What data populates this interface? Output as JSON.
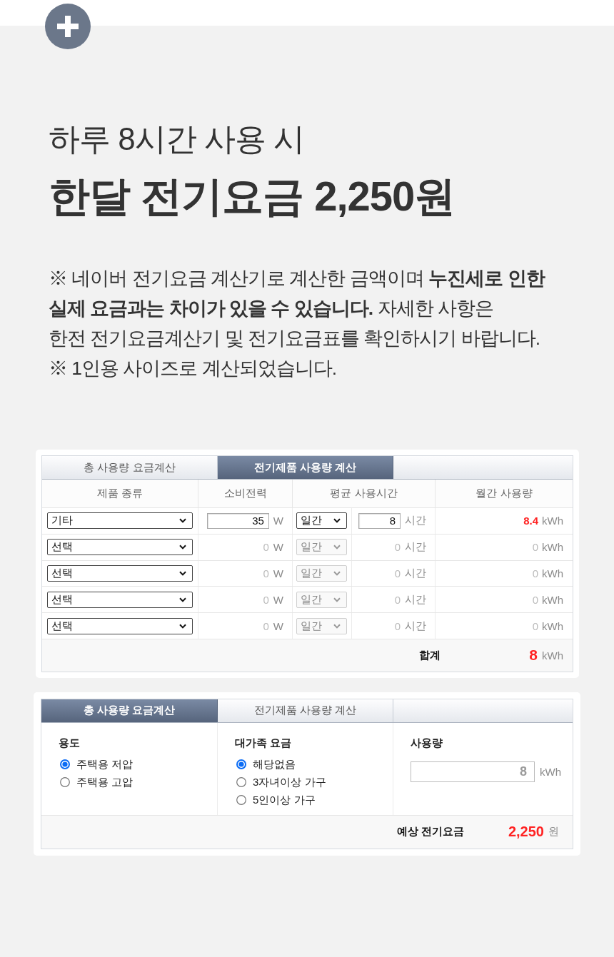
{
  "header": {
    "subtitle": "하루 8시간 사용 시",
    "headline": "한달 전기요금 2,250원"
  },
  "notes": [
    "※ 네이버 전기요금 계산기로 계산한 금액이며 **누진세로 인한**\n**실제 요금과는 차이가 있을 수 있습니다.** 자세한 사항은\n한전 전기요금계산기 및 전기요금표를 확인하시기 바랍니다.",
    "※ 1인용 사이즈로 계산되었습니다."
  ],
  "appliance_calculator": {
    "tabs": [
      {
        "label": "총 사용량 요금계산",
        "selected": false
      },
      {
        "label": "전기제품 사용량 계산",
        "selected": true
      }
    ],
    "columns": [
      "제품 종류",
      "소비전력",
      "평균 사용시간",
      "월간 사용량"
    ],
    "rows": [
      {
        "disabled": false,
        "product": "기타",
        "power": "35",
        "power_unit": "W",
        "period": "일간",
        "hours": "8",
        "hours_unit": "시간",
        "usage": "8.4",
        "usage_unit": "kWh"
      },
      {
        "disabled": true,
        "product": "선택",
        "power": "0",
        "power_unit": "W",
        "period": "일간",
        "hours": "0",
        "hours_unit": "시간",
        "usage": "0",
        "usage_unit": "kWh"
      },
      {
        "disabled": true,
        "product": "선택",
        "power": "0",
        "power_unit": "W",
        "period": "일간",
        "hours": "0",
        "hours_unit": "시간",
        "usage": "0",
        "usage_unit": "kWh"
      },
      {
        "disabled": true,
        "product": "선택",
        "power": "0",
        "power_unit": "W",
        "period": "일간",
        "hours": "0",
        "hours_unit": "시간",
        "usage": "0",
        "usage_unit": "kWh"
      },
      {
        "disabled": true,
        "product": "선택",
        "power": "0",
        "power_unit": "W",
        "period": "일간",
        "hours": "0",
        "hours_unit": "시간",
        "usage": "0",
        "usage_unit": "kWh"
      }
    ],
    "total": {
      "label": "합계",
      "value": "8",
      "unit": "kWh"
    }
  },
  "bill_calculator": {
    "tabs": [
      {
        "label": "총 사용량 요금계산",
        "selected": true
      },
      {
        "label": "전기제품 사용량 계산",
        "selected": false
      }
    ],
    "groups": [
      {
        "kind": "radio",
        "title": "용도",
        "options": [
          {
            "label": "주택용 저압",
            "selected": true
          },
          {
            "label": "주택용 고압",
            "selected": false
          }
        ]
      },
      {
        "kind": "radio",
        "title": "대가족 요금",
        "options": [
          {
            "label": "해당없음",
            "selected": true
          },
          {
            "label": "3자녀이상 가구",
            "selected": false
          },
          {
            "label": "5인이상 가구",
            "selected": false
          }
        ]
      },
      {
        "kind": "input",
        "title": "사용량",
        "value": "8",
        "unit": "kWh"
      }
    ],
    "estimate": {
      "label": "예상 전기요금",
      "value": "2,250",
      "unit": "원"
    }
  }
}
